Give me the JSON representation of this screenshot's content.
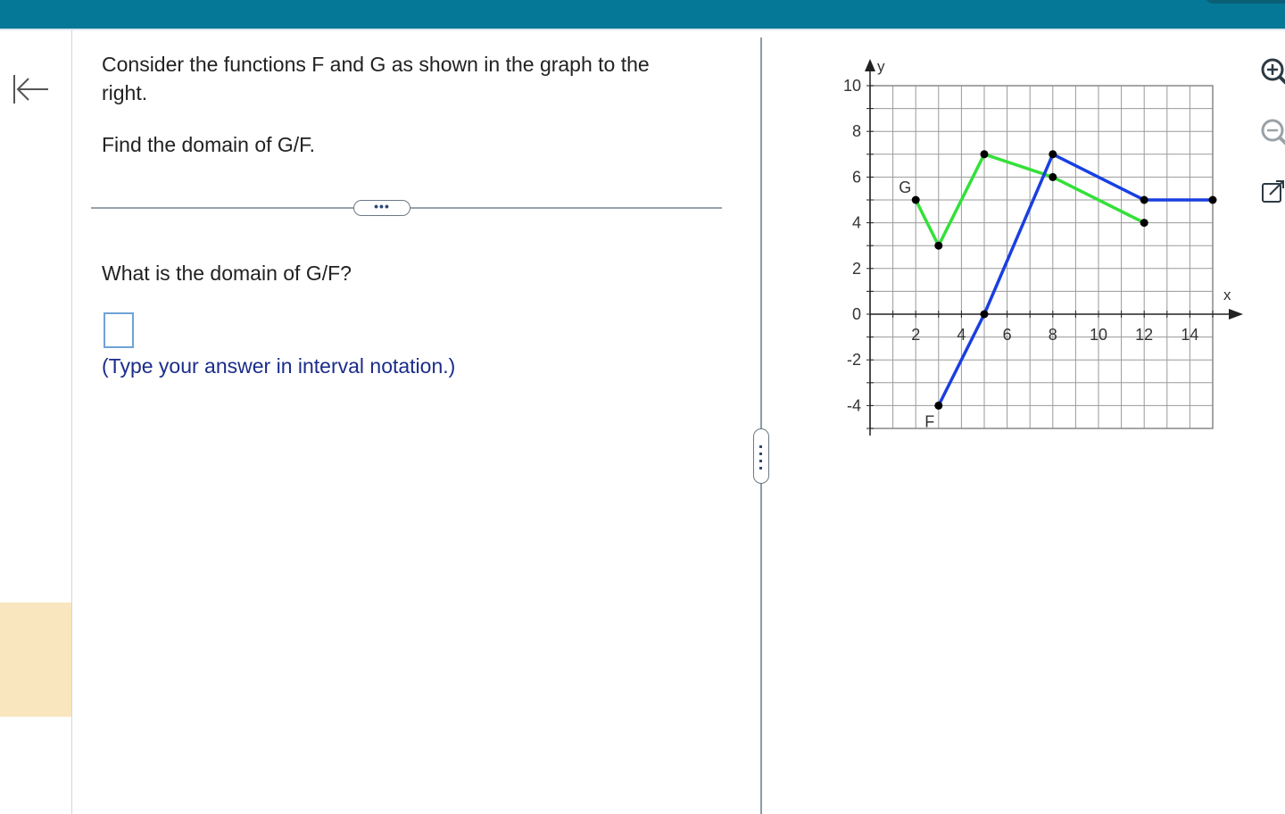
{
  "question": {
    "line1": "Consider the functions F and G as shown in the graph to the right.",
    "line2": "Find the domain of G/F.",
    "expand_label": "•••",
    "prompt": "What is the domain of G/F?",
    "hint": "(Type your answer in interval notation.)"
  },
  "icons": {
    "back": "collapse-left-icon",
    "zoom_in": "zoom-in-icon",
    "zoom_out": "zoom-out-icon",
    "popout": "popout-icon"
  },
  "colors": {
    "topbar": "#047896",
    "f_curve": "#1a3fe0",
    "g_curve": "#33e03a",
    "answer_border": "#6fa3d8",
    "hint_text": "#1b2c8a",
    "rail_highlight": "#f9e6bf"
  },
  "chart_data": {
    "type": "line",
    "xlabel": "x",
    "ylabel": "y",
    "xlim": [
      -1,
      15
    ],
    "ylim": [
      -5,
      10
    ],
    "grid": true,
    "x_ticks": [
      2,
      4,
      6,
      8,
      10,
      12,
      14
    ],
    "y_ticks": [
      -4,
      -2,
      0,
      2,
      4,
      6,
      8,
      10
    ],
    "series": [
      {
        "name": "F",
        "x": [
          3,
          5,
          8,
          12,
          15
        ],
        "y": [
          -4,
          0,
          7,
          5,
          5
        ]
      },
      {
        "name": "G",
        "x": [
          2,
          3,
          5,
          8,
          12
        ],
        "y": [
          5,
          3,
          7,
          6,
          4
        ]
      }
    ]
  }
}
